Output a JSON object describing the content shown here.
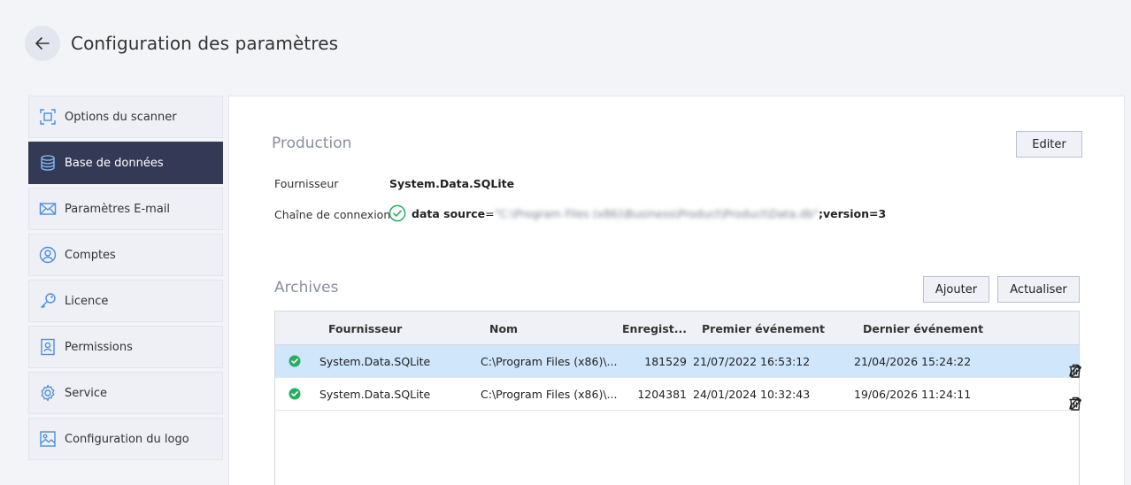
{
  "header": {
    "title": "Configuration des paramètres",
    "back_icon": "arrow-left-icon"
  },
  "sidebar": {
    "items": [
      {
        "label": "Options du scanner",
        "icon": "scan-frame-icon",
        "active": false
      },
      {
        "label": "Base de données",
        "icon": "database-icon",
        "active": true
      },
      {
        "label": "Paramètres E-mail",
        "icon": "envelope-icon",
        "active": false
      },
      {
        "label": "Comptes",
        "icon": "user-circle-icon",
        "active": false
      },
      {
        "label": "Licence",
        "icon": "key-icon",
        "active": false
      },
      {
        "label": "Permissions",
        "icon": "id-badge-icon",
        "active": false
      },
      {
        "label": "Service",
        "icon": "gear-icon",
        "active": false
      },
      {
        "label": "Configuration du logo",
        "icon": "image-icon",
        "active": false
      }
    ]
  },
  "production": {
    "title": "Production",
    "edit_button": "Editer",
    "provider_label": "Fournisseur",
    "provider_value": "System.Data.SQLite",
    "connection_label": "Chaîne de connexion",
    "connection_prefix": "data source",
    "connection_equals": "=",
    "connection_hidden": "\"C:\\Program Files (x86)\\Business\\Product\\Product\\Data.db\"",
    "connection_suffix": ";version=3"
  },
  "archives": {
    "title": "Archives",
    "add_button": "Ajouter",
    "refresh_button": "Actualiser",
    "columns": {
      "provider": "Fournisseur",
      "name": "Nom",
      "records": "Enregist...",
      "first_event": "Premier événement",
      "last_event": "Dernier événement"
    },
    "rows": [
      {
        "provider": "System.Data.SQLite",
        "name": "C:\\Program Files (x86)\\...",
        "records": "181529",
        "first_event": "21/07/2022 16:53:12",
        "last_event": "21/04/2026 15:24:22",
        "selected": true
      },
      {
        "provider": "System.Data.SQLite",
        "name": "C:\\Program Files (x86)\\...",
        "records": "1204381",
        "first_event": "24/01/2024 10:32:43",
        "last_event": "19/06/2026 11:24:11",
        "selected": false
      }
    ]
  },
  "colors": {
    "accent_dark": "#343a56",
    "selected_row": "#cfe6fb",
    "success": "#27ae60"
  }
}
